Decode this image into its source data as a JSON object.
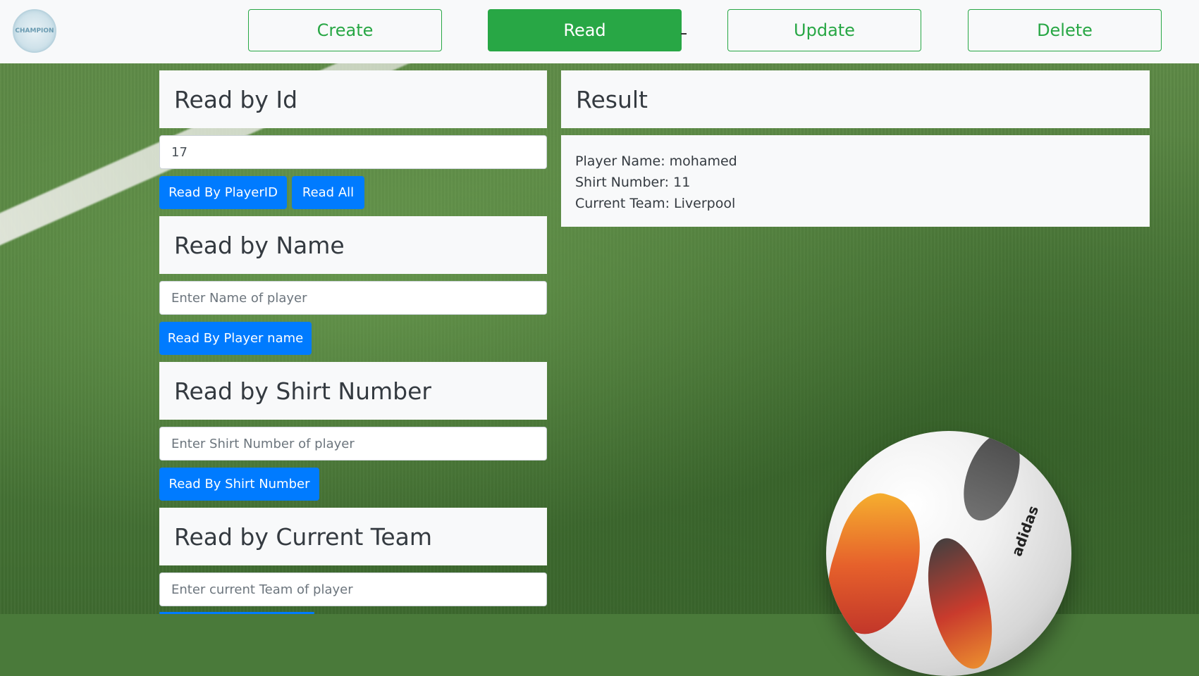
{
  "logo": {
    "text": "CHAMPION"
  },
  "nav": {
    "create": "Create",
    "read": "Read",
    "update": "Update",
    "delete": "Delete"
  },
  "read_by_id": {
    "title": "Read by Id",
    "value": "17",
    "button_by_id": "Read By PlayerID",
    "button_all": "Read All"
  },
  "read_by_name": {
    "title": "Read by Name",
    "placeholder": "Enter Name of player",
    "button": "Read By Player name"
  },
  "read_by_shirt": {
    "title": "Read by Shirt Number",
    "placeholder": "Enter Shirt Number of player",
    "button": "Read By Shirt Number"
  },
  "read_by_team": {
    "title": "Read by Current Team",
    "placeholder": "Enter current Team of player"
  },
  "result": {
    "title": "Result",
    "player_name": "Player Name: mohamed",
    "shirt_number": "Shirt Number: 11",
    "current_team": "Current Team: Liverpool"
  },
  "background": {
    "ball_brand": "adidas"
  },
  "colors": {
    "success": "#28a745",
    "primary": "#007bff",
    "panel": "#f8f9fa"
  }
}
